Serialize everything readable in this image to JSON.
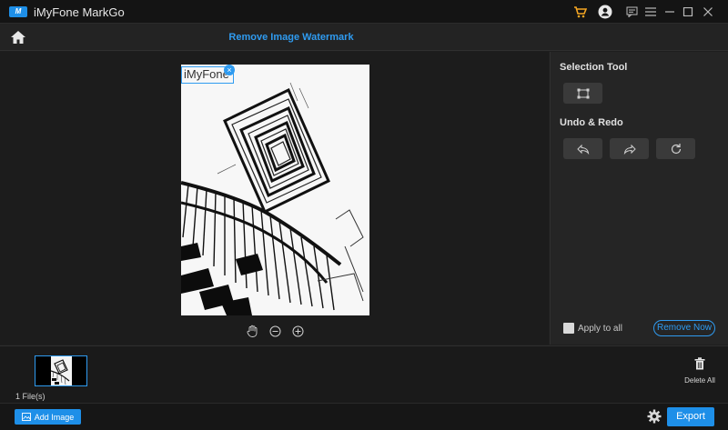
{
  "app": {
    "logo_text": "M",
    "title": "iMyFone MarkGo"
  },
  "toolbar": {
    "page_title": "Remove Image Watermark"
  },
  "canvas": {
    "watermark_text": "iMyFone",
    "watermark_close": "×"
  },
  "right_panel": {
    "selection_tool_label": "Selection Tool",
    "undo_redo_label": "Undo & Redo",
    "apply_all_label": "Apply to all",
    "remove_now_label": "Remove Now"
  },
  "thumbnails": {
    "file_count": "1 File(s)",
    "delete_all_label": "Delete All"
  },
  "bottom": {
    "add_image_label": "Add Image",
    "export_label": "Export"
  },
  "colors": {
    "accent": "#2f9bf0",
    "button_blue": "#1e8fe8",
    "cart_orange": "#f5a623"
  },
  "icons": [
    "cart-icon",
    "account-icon",
    "feedback-icon",
    "menu-icon",
    "minimize-icon",
    "maximize-icon",
    "close-icon",
    "home-icon",
    "hand-icon",
    "zoom-out-icon",
    "zoom-in-icon",
    "rectangle-select-icon",
    "undo-icon",
    "redo-icon",
    "reset-icon",
    "trash-icon",
    "gear-icon",
    "add-image-icon"
  ]
}
